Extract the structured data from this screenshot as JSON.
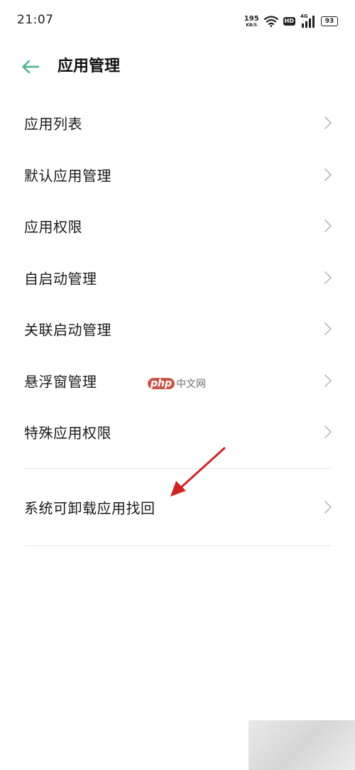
{
  "status_bar": {
    "time": "21:07",
    "net_speed_value": "195",
    "net_speed_unit": "KB/S",
    "hd_label": "HD",
    "network_type": "4G",
    "battery_level": "93"
  },
  "header": {
    "title": "应用管理"
  },
  "menu": {
    "items": [
      {
        "label": "应用列表"
      },
      {
        "label": "默认应用管理"
      },
      {
        "label": "应用权限"
      },
      {
        "label": "自启动管理"
      },
      {
        "label": "关联启动管理"
      },
      {
        "label": "悬浮窗管理"
      },
      {
        "label": "特殊应用权限"
      }
    ],
    "extra_item": {
      "label": "系统可卸载应用找回"
    }
  },
  "watermark": {
    "brand": "php",
    "text": "中文网"
  },
  "colors": {
    "accent": "#4caf8f",
    "annotation_arrow": "#d02424",
    "divider": "#e3e3e3",
    "chevron": "#bdbdbd"
  }
}
